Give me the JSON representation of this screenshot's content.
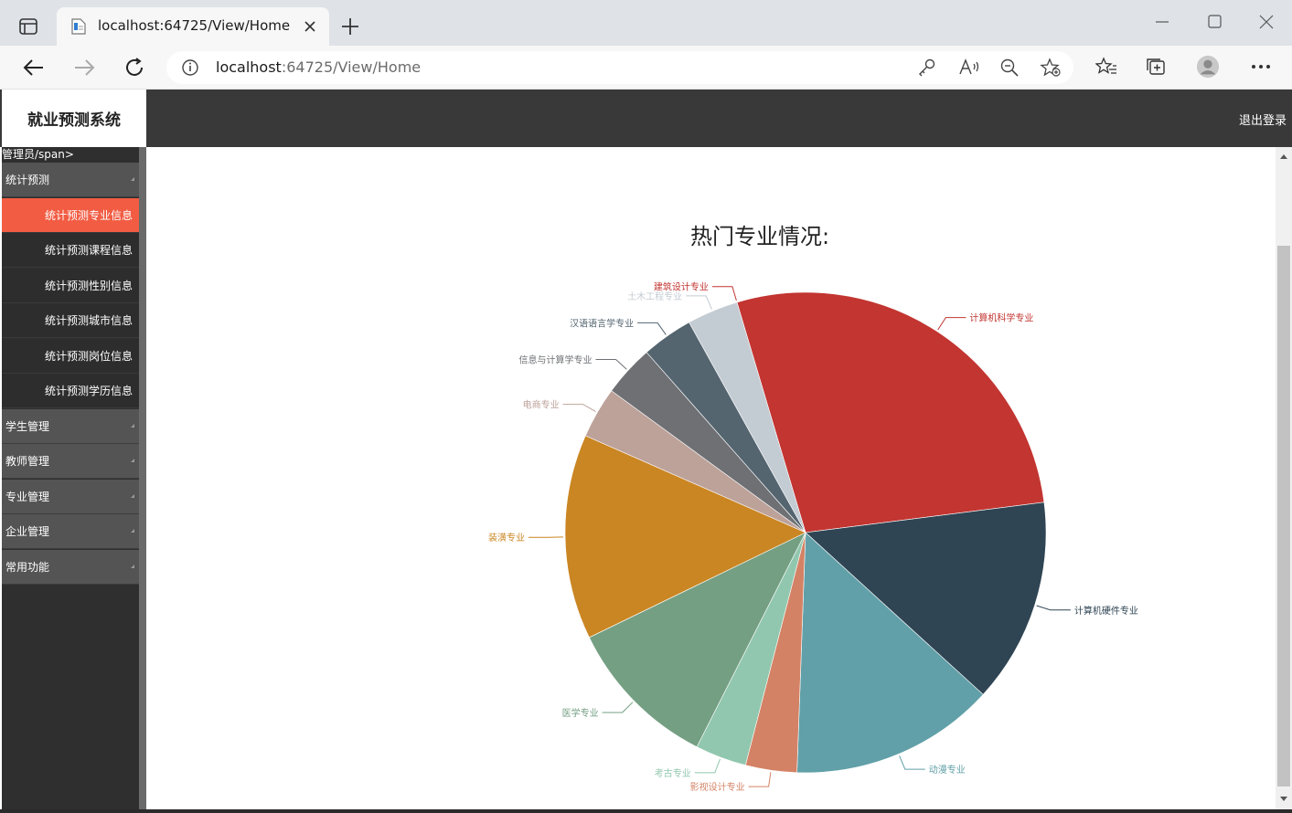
{
  "browser": {
    "tab_title": "localhost:64725/View/Home",
    "url_host": "localhost",
    "url_rest": ":64725/View/Home"
  },
  "app": {
    "title": "就业预测系统",
    "logout": "退出登录",
    "user_line": "管理员/span>"
  },
  "sidebar": {
    "groups": [
      {
        "label": "统计预测"
      },
      {
        "label": "学生管理"
      },
      {
        "label": "教师管理"
      },
      {
        "label": "专业管理"
      },
      {
        "label": "企业管理"
      },
      {
        "label": "常用功能"
      }
    ],
    "sub_items": [
      {
        "label": "统计预测专业信息",
        "active": true
      },
      {
        "label": "统计预测课程信息"
      },
      {
        "label": "统计预测性别信息"
      },
      {
        "label": "统计预测城市信息"
      },
      {
        "label": "统计预测岗位信息"
      },
      {
        "label": "统计预测学历信息"
      }
    ]
  },
  "colors": {
    "header_bg": "#393939",
    "active_menu": "#f25c43",
    "sidebar_bg": "#2f2f2f"
  },
  "chart_data": {
    "type": "pie",
    "title": "热门专业情况:",
    "slices": [
      {
        "name": "计算机科学专业",
        "value": 8,
        "color": "#c23531"
      },
      {
        "name": "计算机硬件专业",
        "value": 4,
        "color": "#2f4554"
      },
      {
        "name": "动漫专业",
        "value": 4,
        "color": "#61a0a8"
      },
      {
        "name": "影视设计专业",
        "value": 1,
        "color": "#d48265"
      },
      {
        "name": "考古专业",
        "value": 1,
        "color": "#91c7ae"
      },
      {
        "name": "医学专业",
        "value": 3,
        "color": "#749f83"
      },
      {
        "name": "装潢专业",
        "value": 4,
        "color": "#ca8622"
      },
      {
        "name": "电商专业",
        "value": 1,
        "color": "#bda29a"
      },
      {
        "name": "信息与计算学专业",
        "value": 1,
        "color": "#6e7074"
      },
      {
        "name": "汉语语言学专业",
        "value": 1,
        "color": "#546570"
      },
      {
        "name": "土木工程专业",
        "value": 1,
        "color": "#c4ccd3"
      },
      {
        "name": "建筑设计专业",
        "value": 0,
        "color": "#c23531"
      }
    ]
  }
}
